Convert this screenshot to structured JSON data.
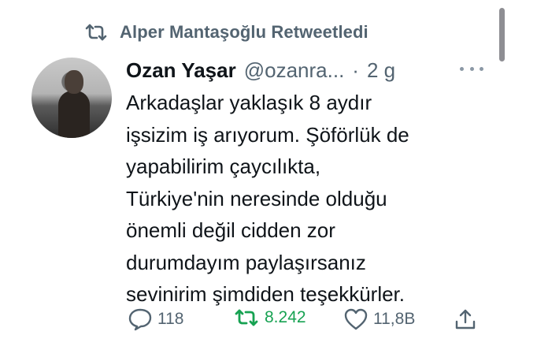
{
  "retweet_header": {
    "icon": "retweet-icon",
    "text": "Alper Mantaşoğlu Retweetledi"
  },
  "tweet": {
    "author": {
      "display_name": "Ozan Yaşar",
      "handle": "@ozanra...",
      "separator": "·",
      "timestamp": "2 g",
      "avatar_icon": "profile-photo"
    },
    "text": "Arkadaşlar yaklaşık 8 aydır\nişsizim iş arıyorum. Şöförlük de\nyapabilirim çaycılıkta,\nTürkiye'nin neresinde olduğu\nönemli değil cidden zor\ndurumdayım paylaşırsanız\nsevinirim şimdiden teşekkürler.",
    "actions": {
      "reply": {
        "icon": "reply-icon",
        "count": "118"
      },
      "retweet": {
        "icon": "retweet-icon",
        "count": "8.242",
        "active": true,
        "color": "#17a252"
      },
      "like": {
        "icon": "heart-icon",
        "count": "11,8B"
      },
      "share": {
        "icon": "share-icon"
      }
    }
  },
  "colors": {
    "secondary_text": "#536471",
    "primary_text": "#0f1419",
    "retweet_active": "#17a252"
  }
}
